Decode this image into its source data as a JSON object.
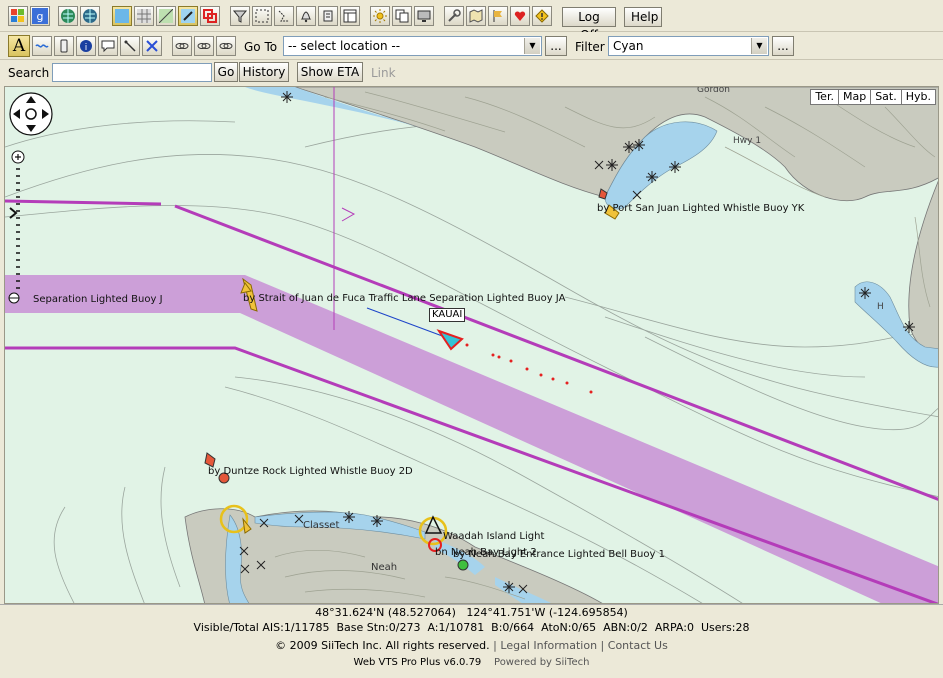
{
  "toolbar": {
    "logoff_label": "Log Off",
    "help_label": "Help"
  },
  "row2": {
    "goto_label": "Go To",
    "goto_value": "-- select location --",
    "ellipsis": "...",
    "filter_label": "Filter",
    "filter_value": "Cyan"
  },
  "row3": {
    "search_label": "Search",
    "search_value": "",
    "go_label": "Go",
    "history_label": "History",
    "show_eta_label": "Show ETA",
    "link_label": "Link"
  },
  "map": {
    "map_types": [
      "Ter.",
      "Map",
      "Sat.",
      "Hyb."
    ],
    "labels": {
      "buoy_j": "Separation Lighted Buoy J",
      "buoy_ja": "by Strait of Juan de Fuca Traffic Lane Separation Lighted Buoy JA",
      "buoy_yk": "by Port San Juan Lighted Whistle Buoy YK",
      "buoy_2d": "by Duntze Rock Lighted Whistle Buoy 2D",
      "waadah": "Waadah Island Light",
      "neah_bay_light": "bn Neah Bay Light 2",
      "bell_buoy": "by Neah Bay Entrance Lighted Bell Buoy 1",
      "clallam": "Classet",
      "neah": "Neah",
      "gordon": "Gordon",
      "road": "Hwy 1",
      "h": "H"
    },
    "vessel_name": "KAUAI",
    "colors": {
      "water": "#e1f3e6",
      "lane": "#cc9fd8",
      "boundary": "#b43cb9",
      "land": "#c8ccc0",
      "coast_water": "#a6d3ec"
    }
  },
  "status": {
    "coords": "48°31.624'N (48.527064)   124°41.751'W (-124.695854)",
    "stats": "Visible/Total AIS:1/11785  Base Stn:0/273  A:1/10781  B:0/664  AtoN:0/65  ABN:0/2  ARPA:0  Users:28",
    "copyright": "© 2009 SiiTech Inc. All rights reserved.",
    "separator": "|",
    "legal": "Legal Information",
    "contact": "Contact Us",
    "version": "Web VTS Pro Plus v6.0.79",
    "powered": "Powered by SiiTech"
  }
}
